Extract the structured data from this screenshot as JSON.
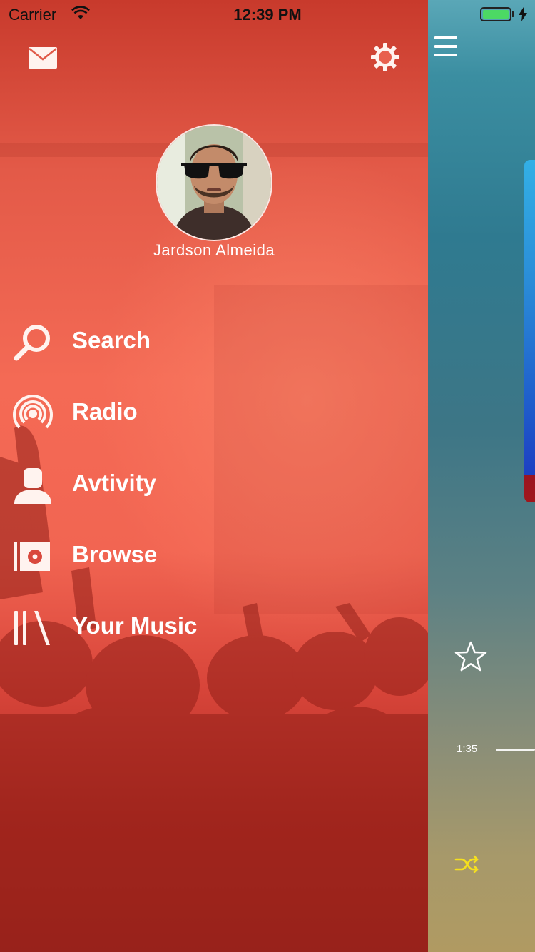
{
  "status_bar": {
    "carrier": "Carrier",
    "time": "12:39 PM",
    "battery_level": 1.0
  },
  "drawer": {
    "header_icons": {
      "left": "mail-icon",
      "right": "gear-icon"
    },
    "profile": {
      "name": "Jardson Almeida",
      "avatar": "avatar-photo"
    },
    "menu": [
      {
        "label": "Search",
        "icon": "search-icon"
      },
      {
        "label": "Radio",
        "icon": "radio-broadcast-icon"
      },
      {
        "label": "Avtivity",
        "icon": "person-icon"
      },
      {
        "label": "Browse",
        "icon": "browse-album-icon"
      },
      {
        "label": "Your Music",
        "icon": "library-icon"
      }
    ]
  },
  "player_panel": {
    "menu_icon": "hamburger-menu-icon",
    "favorite_icon": "star-outline-icon",
    "elapsed_time": "1:35",
    "shuffle_icon": "shuffle-icon",
    "colors": {
      "accent_shuffle": "#f5e01e",
      "drawer_red": "#f26552"
    }
  }
}
